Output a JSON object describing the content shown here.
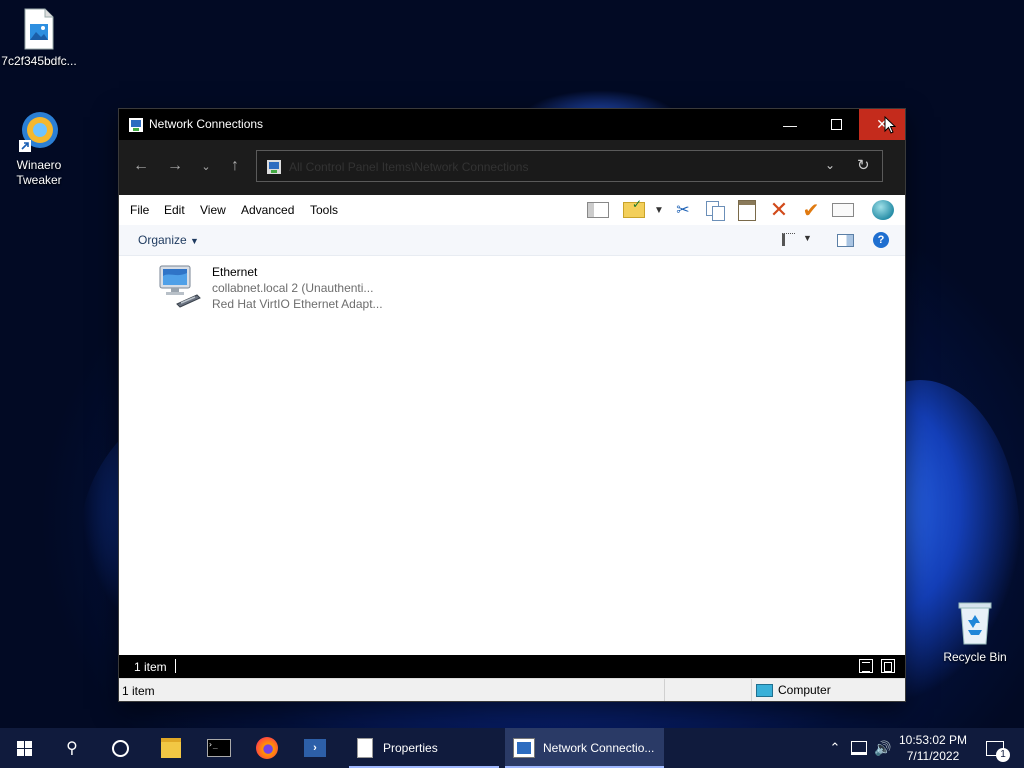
{
  "desktop": {
    "icons": [
      {
        "label": "7c2f345bdfc..."
      },
      {
        "label_line1": "Winaero",
        "label_line2": "Tweaker"
      },
      {
        "label": "Recycle Bin"
      }
    ]
  },
  "window": {
    "title": "Network Connections",
    "address": "All Control Panel Items\\Network Connections",
    "menu": [
      "File",
      "Edit",
      "View",
      "Advanced",
      "Tools"
    ],
    "organize": "Organize",
    "items": [
      {
        "name": "Ethernet",
        "line2": "collabnet.local 2 (Unauthenti...",
        "line3": "Red Hat VirtIO Ethernet Adapt..."
      }
    ],
    "count_bar": "1 item",
    "status_left": "1 item",
    "status_right": "Computer"
  },
  "taskbar": {
    "apps": [
      {
        "label": "Properties"
      },
      {
        "label": "Network Connectio..."
      }
    ],
    "clock_time": "10:53:02 PM",
    "clock_date": "7/11/2022",
    "notification_count": "1"
  }
}
